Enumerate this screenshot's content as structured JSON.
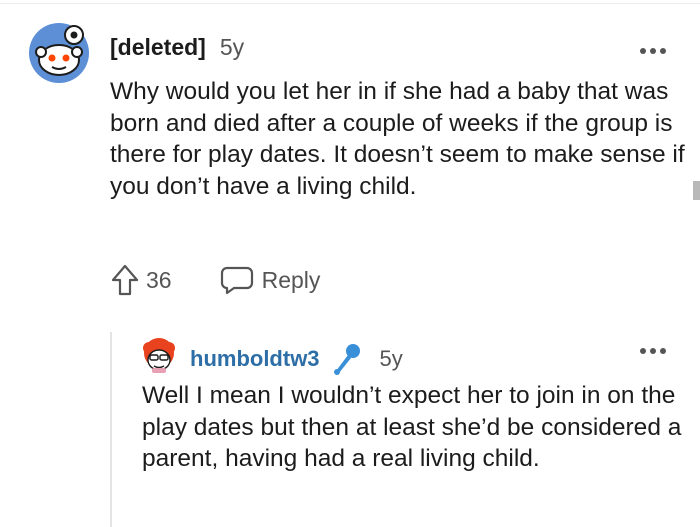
{
  "comment": {
    "author": "[deleted]",
    "age": "5y",
    "body": "Why would you let her in if she had a baby that was born and died after a couple of weeks if the group is there for play dates. It doesn’t seem to make sense if you don’t have a living child.",
    "votes": "36",
    "reply_label": "Reply",
    "avatar_icon": "snoo-avatar-icon",
    "more_icon": "more-options-icon"
  },
  "reply": {
    "author": "humboldtw3",
    "flair_icon": "microphone-icon",
    "age": "5y",
    "body": "Well I mean I wouldn’t expect her to join in on the play dates but then at least she’d be considered a parent, having had a real living child.",
    "avatar_icon": "user-avatar-icon",
    "more_icon": "more-options-icon"
  },
  "colors": {
    "author_link": "#2e6ea6",
    "avatar_blue": "#5c8fd6",
    "mic_blue": "#3a8fd9",
    "thread_line": "#e4e4e4"
  }
}
